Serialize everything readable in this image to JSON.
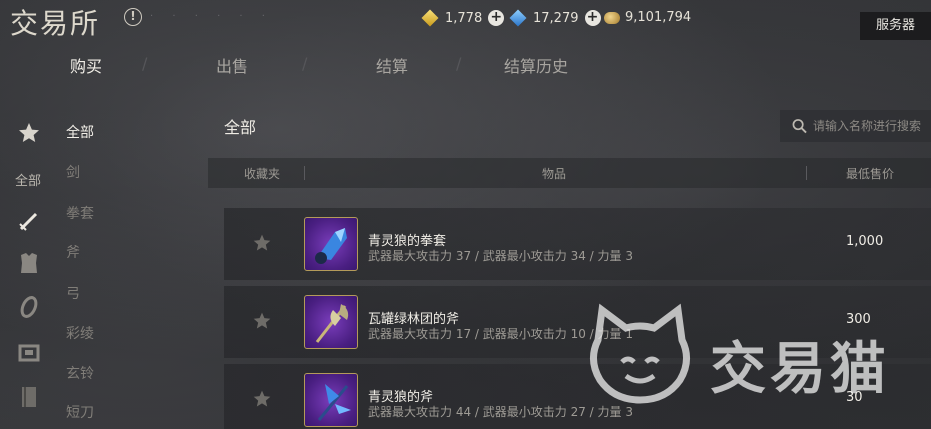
{
  "app": {
    "title": "交易所",
    "info_icon": "info-circle-icon",
    "server_button": "服务器"
  },
  "currencies": [
    {
      "icon": "gold-gem-icon",
      "value": "1,778"
    },
    {
      "icon": "blue-gem-icon",
      "value": "17,279"
    },
    {
      "icon": "coin-pile-icon",
      "value": "9,101,794"
    }
  ],
  "tabs": [
    {
      "label": "购买",
      "active": true
    },
    {
      "label": "出售",
      "active": false
    },
    {
      "label": "结算",
      "active": false
    },
    {
      "label": "结算历史",
      "active": false
    }
  ],
  "sidebar": {
    "all_label": "全部",
    "icons": [
      "star-icon",
      "sword-icon",
      "armor-icon",
      "ring-icon",
      "chest-icon",
      "book-icon"
    ]
  },
  "categories": [
    {
      "label": "全部",
      "active": true
    },
    {
      "label": "剑",
      "active": false
    },
    {
      "label": "拳套",
      "active": false
    },
    {
      "label": "斧",
      "active": false
    },
    {
      "label": "弓",
      "active": false
    },
    {
      "label": "彩绫",
      "active": false
    },
    {
      "label": "玄铃",
      "active": false
    },
    {
      "label": "短刀",
      "active": false
    }
  ],
  "main": {
    "section_title": "全部",
    "search_placeholder": "请输入名称进行搜索",
    "columns": {
      "favorite": "收藏夹",
      "item": "物品",
      "min_price": "最低售价"
    }
  },
  "items": [
    {
      "name": "青灵狼的拳套",
      "stats": "武器最大攻击力 37   / 武器最小攻击力 34   / 力量 3",
      "price": "1,000",
      "icon": "gauntlet-icon"
    },
    {
      "name": "瓦罐绿林团的斧",
      "stats": "武器最大攻击力 17   / 武器最小攻击力 10   / 力量 1",
      "price": "300",
      "icon": "axe-icon"
    },
    {
      "name": "青灵狼的斧",
      "stats": "武器最大攻击力 44   / 武器最小攻击力 27   / 力量 3",
      "price": "30",
      "icon": "blue-axe-icon"
    }
  ],
  "watermark": {
    "text": "交易猫",
    "icon": "cat-logo-icon"
  },
  "colors": {
    "active_text": "#f2efe8",
    "muted_text": "#807d78",
    "thumb_frame": "#b49b5a",
    "thumb_bg": "#5a2a9a"
  }
}
